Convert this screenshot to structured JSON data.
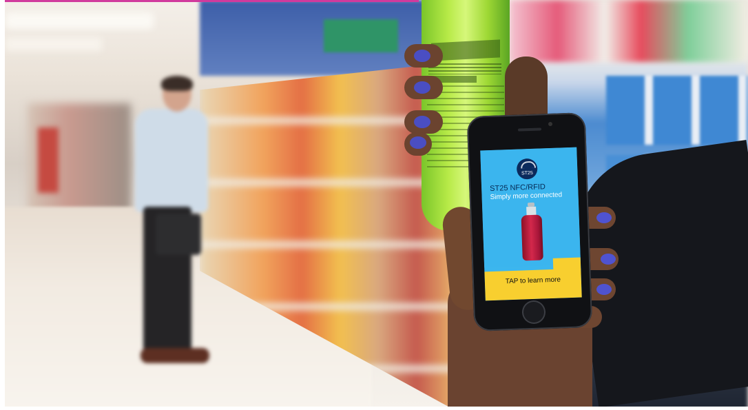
{
  "phone_screen": {
    "badge_text": "ST25",
    "headline": "ST25 NFC/RFID",
    "subline": "Simply more connected",
    "cta": "TAP to learn more"
  },
  "colors": {
    "screen_blue": "#3cb6ee",
    "cta_yellow": "#f8cf2f",
    "nail_polish": "#4a4ec3",
    "bottle_green": "#9ed834"
  }
}
